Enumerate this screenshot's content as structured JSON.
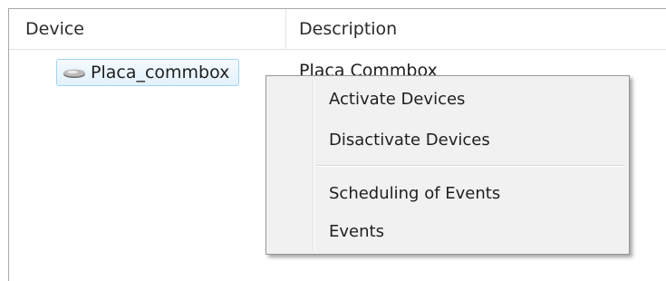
{
  "table": {
    "columns": [
      "Device",
      "Description"
    ],
    "rows": [
      {
        "icon": "device-icon",
        "device": "Placa_commbox",
        "description": "Placa Commbox"
      }
    ]
  },
  "context_menu": {
    "items": [
      {
        "label": "Activate Devices"
      },
      {
        "label": "Disactivate Devices"
      },
      {
        "label": "Scheduling of Events"
      },
      {
        "label": "Events"
      }
    ]
  },
  "colors": {
    "selection_border": "#9ed3f5",
    "selection_fill": "#e2f1fc",
    "menu_background": "#f1f1f1",
    "menu_border": "#979797"
  }
}
